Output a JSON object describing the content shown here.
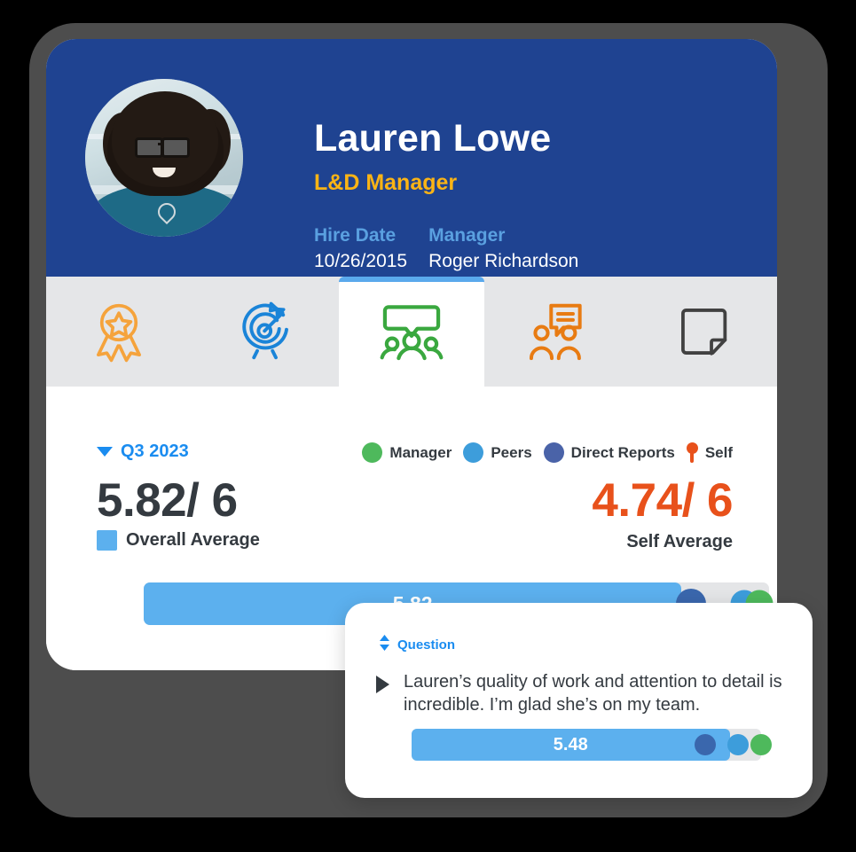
{
  "colors": {
    "header_blue": "#1f4391",
    "accent_blue": "#1a8cf0",
    "bar_blue": "#5cb0ee",
    "self_orange": "#e8511b",
    "role_yellow": "#fbb415",
    "manager_green": "#4eb95c",
    "peers_blue": "#3d9ddb",
    "direct_reports_blue": "#4a63a8",
    "tabbar_gray": "#e5e6e8",
    "text_dark": "#343a40",
    "frame_gray": "#4d4d4d"
  },
  "profile": {
    "name": "Lauren Lowe",
    "role": "L&D Manager",
    "avatar_alt": "avatar-photo",
    "fields": [
      {
        "label": "Hire Date",
        "value": "10/26/2015"
      },
      {
        "label": "Manager",
        "value": "Roger Richardson"
      }
    ]
  },
  "tabs": [
    {
      "name": "tab-recognition",
      "icon": "award-ribbon-icon",
      "color": "#f5a33c",
      "active": false
    },
    {
      "name": "tab-goals",
      "icon": "target-arrow-icon",
      "color": "#1a84d8",
      "active": false
    },
    {
      "name": "tab-feedback",
      "icon": "group-speech-bubble-icon",
      "color": "#3aa83f",
      "active": true
    },
    {
      "name": "tab-one-on-ones",
      "icon": "two-people-chat-icon",
      "color": "#e87b12",
      "active": false
    },
    {
      "name": "tab-notes",
      "icon": "note-page-icon",
      "color": "#414141",
      "active": false
    }
  ],
  "filter": {
    "period_label": "Q3 2023",
    "caret_icon": "caret-down-icon"
  },
  "legend": [
    {
      "label": "Manager",
      "color": "#4eb95c",
      "shape": "dot"
    },
    {
      "label": "Peers",
      "color": "#3d9ddb",
      "shape": "dot"
    },
    {
      "label": "Direct Reports",
      "color": "#4a63a8",
      "shape": "dot"
    },
    {
      "label": "Self",
      "color": "#e8511b",
      "shape": "pin"
    }
  ],
  "scores": {
    "overall": {
      "value": "5.82",
      "denominator": "/ 6",
      "label": "Overall Average",
      "swatch_color": "#5cb0ee"
    },
    "self": {
      "value": "4.74",
      "denominator": "/ 6",
      "label": "Self Average",
      "color": "#e8511b"
    }
  },
  "overall_bar": {
    "value_label": "5.82",
    "fill_percent": 86,
    "self_percent": 79,
    "markers": [
      {
        "name": "direct-reports-marker",
        "color": "#3a67ad",
        "percent": 87.5
      },
      {
        "name": "peers-marker",
        "color": "#3d9ddb",
        "percent": 96
      },
      {
        "name": "manager-marker",
        "color": "#4eb95c",
        "percent": 98.5
      }
    ]
  },
  "popup": {
    "header_label": "Question",
    "sort_icon": "sort-updown-icon",
    "expand_icon": "triangle-right-icon",
    "question_text": "Lauren’s quality of work and attention to detail is incredible. I’m glad she’s on my team.",
    "bar": {
      "value_label": "5.48",
      "fill_percent": 91,
      "self_percent": 99,
      "markers": [
        {
          "name": "direct-reports-marker",
          "color": "#3a67ad",
          "percent": 84
        },
        {
          "name": "peers-marker",
          "color": "#3d9ddb",
          "percent": 93.5
        },
        {
          "name": "manager-marker",
          "color": "#4eb95c",
          "percent": 100
        }
      ]
    }
  }
}
